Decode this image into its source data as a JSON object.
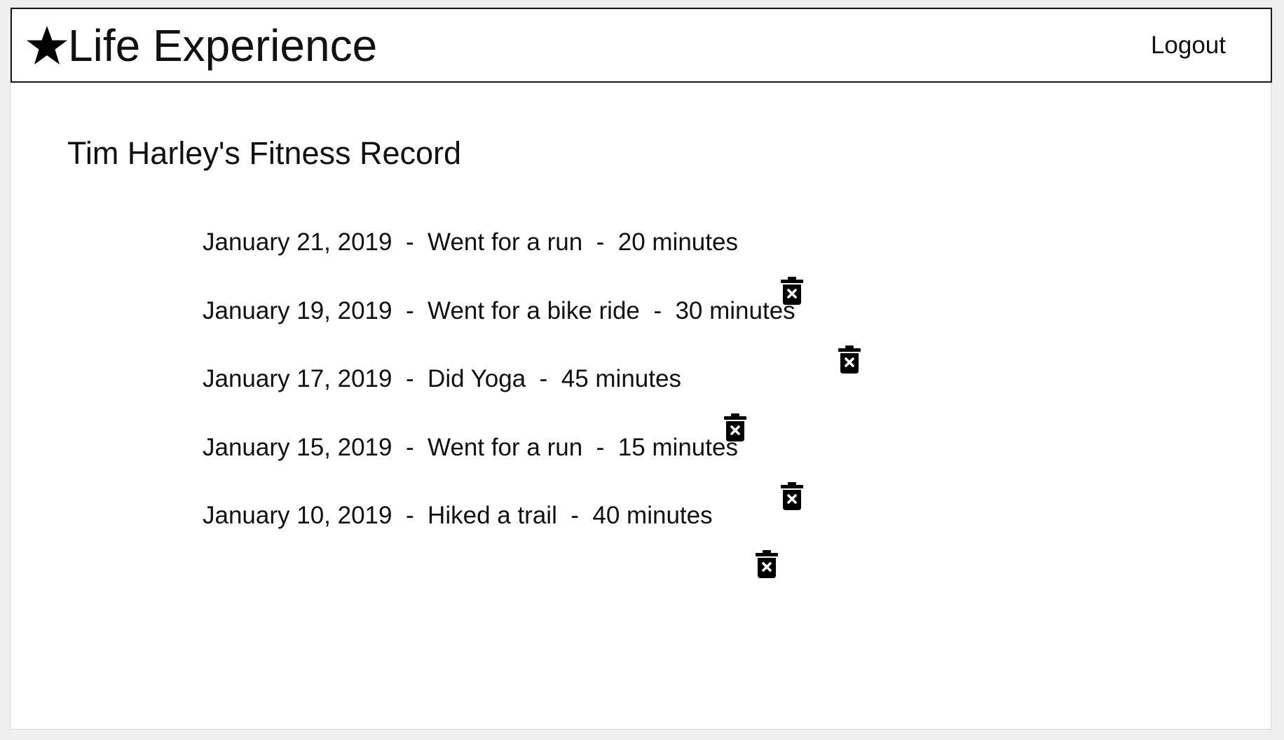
{
  "header": {
    "brand_icon": "star-icon",
    "brand_name": "Life Experience",
    "logout_label": "Logout"
  },
  "main": {
    "title": "Tim Harley's Fitness Record",
    "separator": "-",
    "delete_icon": "trash-x-icon",
    "records": [
      {
        "date": "January 21, 2019",
        "activity": "Went for a run",
        "duration": "20 minutes"
      },
      {
        "date": "January 19, 2019",
        "activity": "Went for a bike ride",
        "duration": "30 minutes"
      },
      {
        "date": "January 17, 2019",
        "activity": "Did Yoga",
        "duration": "45 minutes"
      },
      {
        "date": "January 15, 2019",
        "activity": "Went for a run",
        "duration": "15 minutes"
      },
      {
        "date": "January 10, 2019",
        "activity": "Hiked a trail",
        "duration": "40 minutes"
      }
    ]
  },
  "colors": {
    "background": "#efefef",
    "surface": "#ffffff",
    "text": "#111111",
    "border": "#1a1a1a"
  }
}
